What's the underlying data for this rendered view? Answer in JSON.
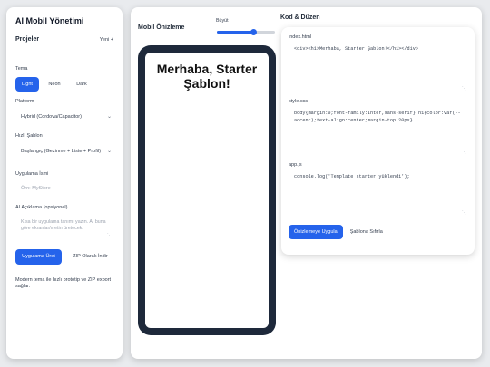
{
  "sidebar": {
    "app_title": "AI Mobil Yönetimi",
    "projects_title": "Projeler",
    "new_label": "Yeni +",
    "theme": {
      "label": "Tema",
      "options": [
        "Light",
        "Neon",
        "Dark"
      ],
      "selected": "Light"
    },
    "platform": {
      "label": "Platform",
      "value": "Hybrid (Cordova/Capacitor)"
    },
    "quick_template": {
      "label": "Hızlı Şablon",
      "value": "Başlangıç (Gezinme + Liste + Profil)"
    },
    "app_name": {
      "label": "Uygulama İsmi",
      "placeholder": "Örn: MyStore"
    },
    "ai_description": {
      "label": "AI Açıklama (opsiyonel)",
      "placeholder": "Kısa bir uygulama tanımı yazın. AI buna göre ekranlar/metin üretecek."
    },
    "generate_button": "Uygulama Üret",
    "download_zip_button": "ZIP Olarak İndir",
    "footnote": "Modern tema ile hızlı prototip ve ZIP export sağlar."
  },
  "preview": {
    "title": "Mobil Önizleme",
    "zoom_label": "Büyüt",
    "zoom_level": 0.62,
    "screen_heading": "Merhaba, Starter Şablon!"
  },
  "code": {
    "title": "Kod & Düzen",
    "files": [
      {
        "name": "index.html",
        "content": "<div><h1>Merhaba, Starter Şablon!</h1></div>"
      },
      {
        "name": "style.css",
        "content": "body{margin:0;font-family:Inter,sans-serif} h1{color:var(--accent);text-align:center;margin-top:20px}"
      },
      {
        "name": "app.js",
        "content": "console.log('Template starter yüklendi');"
      }
    ],
    "apply_button": "Önizlemeye Uygula",
    "reset_button": "Şablona Sıfırla"
  },
  "colors": {
    "accent": "#2563eb",
    "phone_frame": "#1e293b",
    "background": "#e9ebee"
  }
}
